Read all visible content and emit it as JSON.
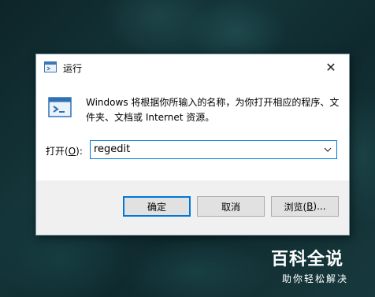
{
  "window": {
    "title": "运行",
    "close_symbol": "✕"
  },
  "description": "Windows 将根据你所输入的名称，为你打开相应的程序、文件夹、文档或 Internet 资源。",
  "open_field": {
    "label_prefix": "打开(",
    "label_hotkey": "O",
    "label_suffix": "):",
    "value": "regedit"
  },
  "buttons": {
    "ok": "确定",
    "cancel": "取消",
    "browse_prefix": "浏览(",
    "browse_hotkey": "B",
    "browse_suffix": ")..."
  },
  "watermark": {
    "main": "百科全说",
    "sub": "助你轻松解决"
  },
  "colors": {
    "accent": "#0078d7",
    "dialog_bg": "#ffffff",
    "footer_bg": "#f0f0f0",
    "button_bg": "#e1e1e1"
  },
  "icons": [
    "run-app-icon",
    "close-icon",
    "chevron-down-icon"
  ]
}
